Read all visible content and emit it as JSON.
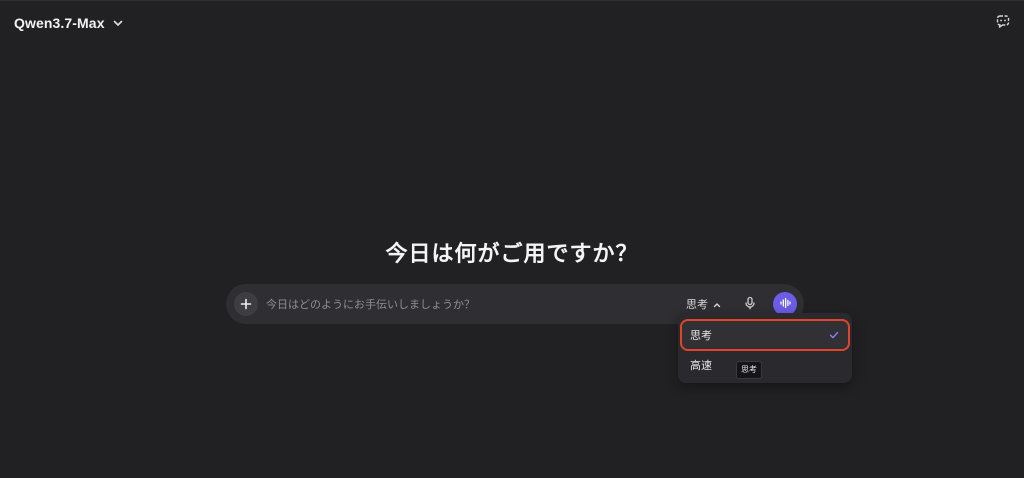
{
  "header": {
    "model_name": "Qwen3.7-Max",
    "dropdown_icon": "chevron-down-icon",
    "temp_chat_icon": "temporary-chat-icon"
  },
  "main": {
    "greeting": "今日は何がご用ですか？"
  },
  "input": {
    "placeholder": "今日はどのようにお手伝いしましょうか？",
    "add_icon": "plus-icon",
    "mode_label": "思考",
    "mode_icon": "chevron-up-icon",
    "mic_icon": "microphone-icon",
    "voice_icon": "voice-wave-icon",
    "accent_color": "#6c5ce7"
  },
  "mode_menu": {
    "options": [
      {
        "label": "思考",
        "selected": true
      },
      {
        "label": "高速",
        "selected": false
      }
    ],
    "check_icon": "check-icon",
    "highlight_color": "#e0452c",
    "tooltip": "思考"
  }
}
